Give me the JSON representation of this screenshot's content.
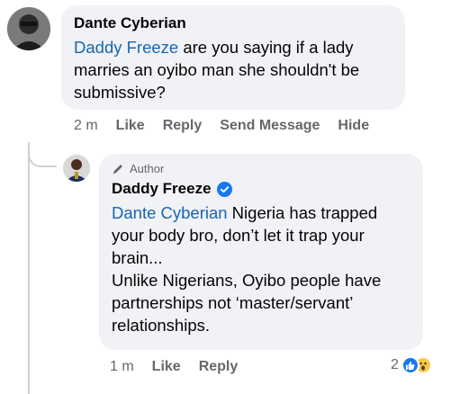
{
  "comment": {
    "author": "Dante Cyberian",
    "mention": "Daddy Freeze",
    "text": " are you saying if a lady marries an oyibo man she shouldn't be submissive?",
    "time": "2 m",
    "actions": [
      "Like",
      "Reply",
      "Send Message",
      "Hide"
    ]
  },
  "reply": {
    "badge": "Author",
    "author": "Daddy Freeze",
    "mention": "Dante Cyberian",
    "text_1": " Nigeria has trapped your body bro, don’t let it trap your brain...",
    "text_2": "Unlike Nigerians, Oyibo people have partnerships not ‘master/servant’ relationships.",
    "time": "1 m",
    "actions": [
      "Like",
      "Reply"
    ],
    "reaction_count": "2",
    "reactions": [
      "like-icon",
      "wow-icon"
    ]
  },
  "colors": {
    "bubble": "#f0f2f5",
    "mention": "#1866b4",
    "meta": "#65676b",
    "like": "#1877f2"
  }
}
